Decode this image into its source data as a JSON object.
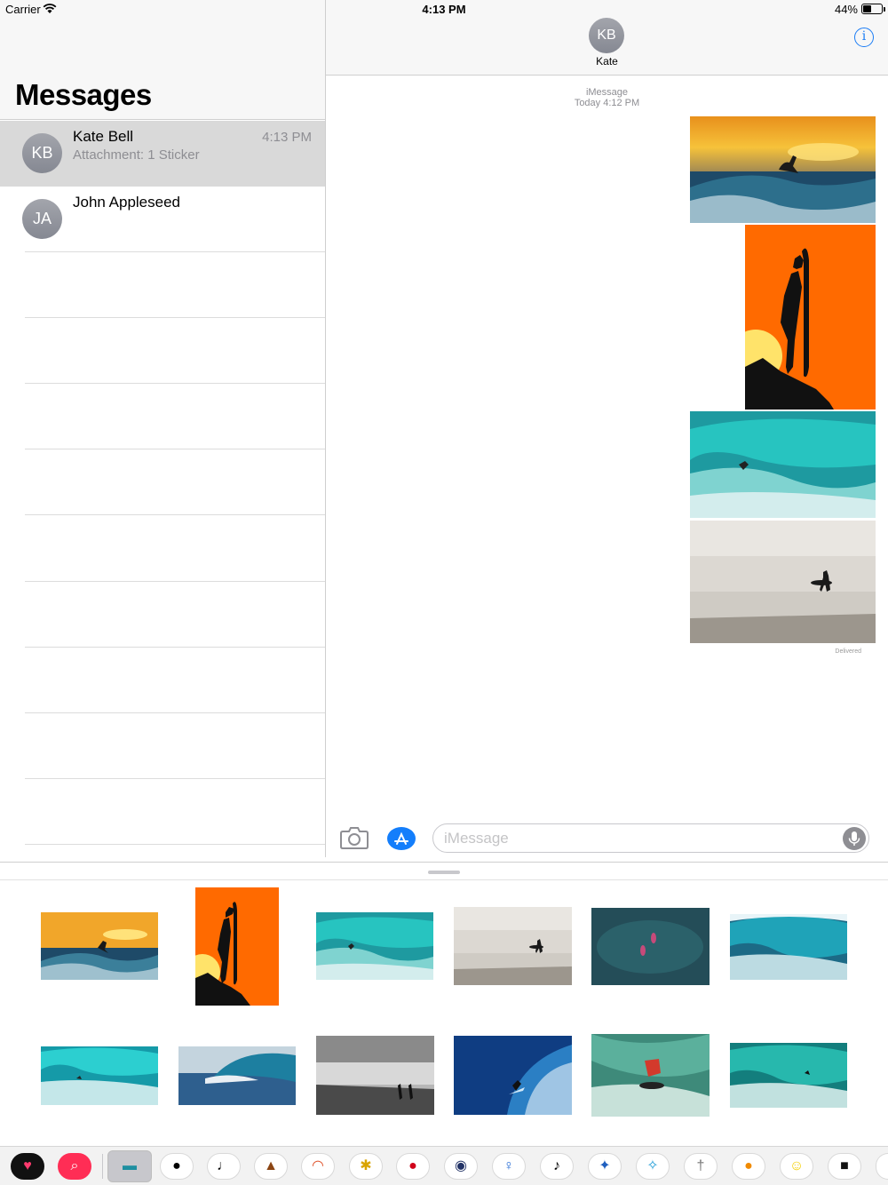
{
  "status_bar": {
    "carrier": "Carrier",
    "time": "4:13 PM",
    "battery": "44%",
    "battery_level": 0.44
  },
  "sidebar": {
    "title": "Messages",
    "conversations": [
      {
        "initials": "KB",
        "name": "Kate Bell",
        "preview": "Attachment: 1 Sticker",
        "time": "4:13 PM"
      },
      {
        "initials": "JA",
        "name": "John Appleseed",
        "preview": "",
        "time": ""
      }
    ]
  },
  "chat": {
    "contact_initials": "KB",
    "contact_name": "Kate",
    "info_icon": "info-icon",
    "service": "iMessage",
    "date": "Today 4:12 PM",
    "delivered": "Delivered",
    "input_placeholder": "iMessage"
  },
  "stickers": {
    "row1": [
      "sunset-surfer",
      "orange-silhouette",
      "teal-wave-surfer",
      "misty-beach-surfer",
      "aerial-ocean-surfers",
      "barrel-wave"
    ],
    "row2": [
      "teal-barrel-surfer",
      "blue-wave",
      "gray-beach-surfers",
      "deep-blue-wave-surfer",
      "red-shirt-surfer",
      "green-barrel-surfer"
    ]
  },
  "app_strip": {
    "icons": [
      "heart-app-icon",
      "search-app-icon",
      "surf-stickers-app-icon",
      "hat-icon",
      "guitar-icon",
      "bird-icon",
      "rainbow-icon",
      "bee-icon",
      "ladybug-icon",
      "globe-icon",
      "balloon-icon",
      "music-note-icon",
      "runner-icon",
      "dancer-icon",
      "skeleton-icon",
      "pumpkin-icon",
      "smiley-icon",
      "pig-icon",
      "bird2-icon"
    ]
  },
  "colors": {
    "accent": "#1a7cf5",
    "avatar": "#8e8e93",
    "selected": "#d9d9d9",
    "app_store_button": "#147efb"
  }
}
